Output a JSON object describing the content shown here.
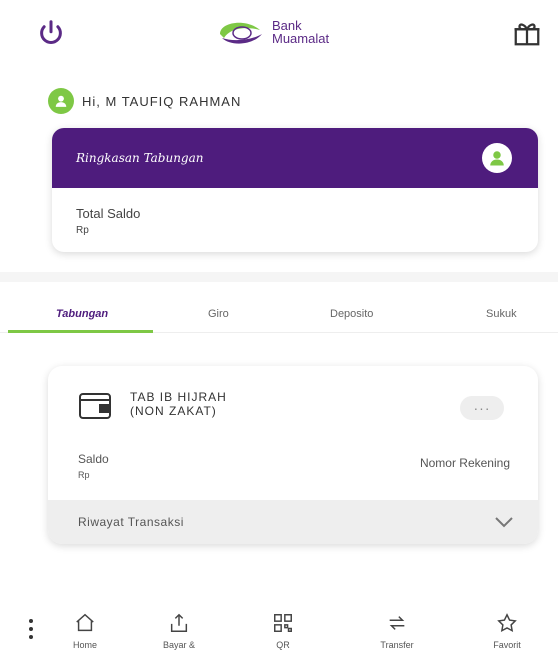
{
  "header": {
    "logo_line1": "Bank",
    "logo_line2": "Muamalat",
    "brand_color": "#5b2a86",
    "icons": [
      "power-icon",
      "gift-icon"
    ]
  },
  "greeting": {
    "text": "Hi, M TAUFIQ RAHMAN"
  },
  "summary": {
    "title": "Ringkasan Tabungan",
    "total_label": "Total Saldo",
    "total_value": "Rp",
    "header_color": "#4e1c7d"
  },
  "tabs": [
    {
      "label": "Tabungan",
      "active": true
    },
    {
      "label": "Giro",
      "active": false
    },
    {
      "label": "Deposito",
      "active": false
    },
    {
      "label": "Sukuk",
      "active": false
    }
  ],
  "account": {
    "name_line1": "TAB IB HIJRAH",
    "name_line2": "(NON ZAKAT)",
    "more_label": "···",
    "saldo_label": "Saldo",
    "saldo_value": "Rp",
    "norek_label": "Nomor Rekening",
    "history_label": "Riwayat Transaksi"
  },
  "bottom_nav": [
    {
      "label": "Home",
      "icon": "home-icon"
    },
    {
      "label": "Bayar &",
      "icon": "pay-icon"
    },
    {
      "label": "QR",
      "icon": "qr-icon"
    },
    {
      "label": "Transfer",
      "icon": "transfer-icon"
    },
    {
      "label": "Favorit",
      "icon": "star-icon"
    }
  ],
  "accent_color": "#7ec845"
}
